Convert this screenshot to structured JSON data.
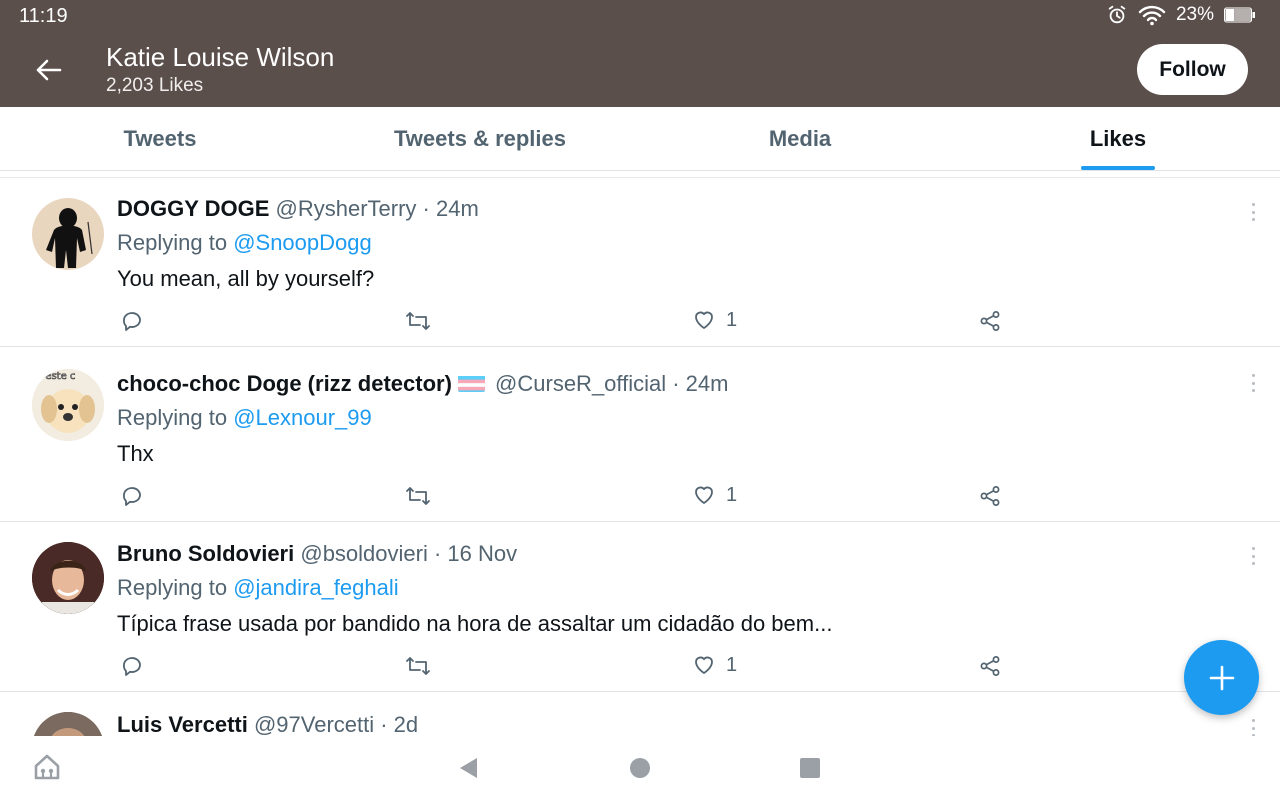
{
  "status_bar": {
    "time": "11:19",
    "battery_percent": "23%",
    "icons": [
      "alarm-icon",
      "wifi-icon",
      "battery-icon"
    ]
  },
  "profile": {
    "name": "Katie Louise Wilson",
    "likes_count": "2,203 Likes",
    "follow_label": "Follow"
  },
  "tabs": [
    {
      "label": "Tweets"
    },
    {
      "label": "Tweets & replies"
    },
    {
      "label": "Media"
    },
    {
      "label": "Likes",
      "active": true
    }
  ],
  "tweets": [
    {
      "name": "DOGGY DOGE",
      "meta": " @RysherTerry · 24m",
      "replying_prefix": "Replying to ",
      "replying_to": "@SnoopDogg",
      "text": "You mean, all by yourself?",
      "likes": "1"
    },
    {
      "name": "choco-choc Doge (rizz detector)",
      "meta": " @CurseR_official · 24m",
      "replying_prefix": "Replying to ",
      "replying_to": "@Lexnour_99",
      "text": "Thx",
      "likes": "1"
    },
    {
      "name": "Bruno Soldovieri",
      "meta": " @bsoldovieri · 16 Nov",
      "replying_prefix": "Replying to ",
      "replying_to": "@jandira_feghali",
      "text": "Típica frase usada por bandido na hora de assaltar um cidadão do bem...",
      "likes": "1"
    },
    {
      "name": "Luis Vercetti",
      "meta": " @97Vercetti · 2d"
    }
  ],
  "colors": {
    "header_bg": "#5b4f4c",
    "accent": "#1d9bf0",
    "muted_text": "#536471"
  }
}
